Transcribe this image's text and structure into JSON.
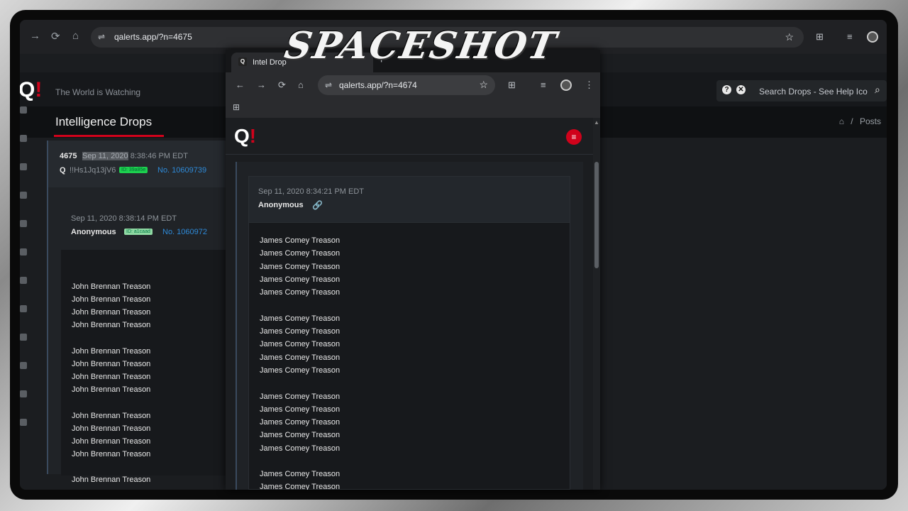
{
  "back_browser": {
    "url": "qalerts.app/?n=4675",
    "site": {
      "tagline": "The World is Watching",
      "search_placeholder": "Search Drops - See Help Ico",
      "section_title": "Intelligence Drops",
      "breadcrumb": "Posts"
    },
    "drop": {
      "number": "4675",
      "date_highlight": "Sep 11, 2020",
      "time": "8:38:46 PM EDT",
      "author": "Q",
      "tripcode": "!!Hs1Jq13jV6",
      "id_badge": "ID: 39a85e",
      "post_no": "No. 10609739"
    },
    "quote": {
      "date": "Sep 11, 2020 8:38:14 PM EDT",
      "author": "Anonymous",
      "id_badge": "ID: a1caad",
      "post_no": "No. 1060972",
      "lines": [
        "John Brennan Treason",
        "John Brennan Treason",
        "John Brennan Treason",
        "John Brennan Treason",
        "John Brennan Treason",
        "John Brennan Treason",
        "John Brennan Treason",
        "John Brennan Treason",
        "John Brennan Treason",
        "John Brennan Treason",
        "John Brennan Treason",
        "John Brennan Treason",
        "John Brennan Treason"
      ]
    }
  },
  "front_browser": {
    "tab_title": "Intel Drop",
    "url": "qalerts.app/?n=4674",
    "post": {
      "date": "Sep 11, 2020 8:34:21 PM EDT",
      "author": "Anonymous",
      "lines": [
        "James Comey Treason",
        "James Comey Treason",
        "James Comey Treason",
        "James Comey Treason",
        "James Comey Treason",
        "James Comey Treason",
        "James Comey Treason",
        "James Comey Treason",
        "James Comey Treason",
        "James Comey Treason",
        "James Comey Treason",
        "James Comey Treason",
        "James Comey Treason",
        "James Comey Treason",
        "James Comey Treason",
        "James Comey Treason",
        "James Comey Treason"
      ]
    }
  },
  "logo": {
    "letter": "Q",
    "mark": "!"
  },
  "watermark": "SPACESHOT",
  "icons": {
    "back": "←",
    "forward": "→",
    "reload": "⟳",
    "home": "⌂",
    "star": "☆",
    "menu": "≡",
    "help": "?",
    "close": "✕",
    "search": "⌕",
    "house": "⌂",
    "link": "🔗",
    "plus": "+",
    "apps": "⊞",
    "tune": "⇌",
    "dots": "⋮"
  },
  "colors": {
    "accent_red": "#d0021b",
    "link_blue": "#2e8ad8",
    "badge_green": "#1dd14f"
  }
}
